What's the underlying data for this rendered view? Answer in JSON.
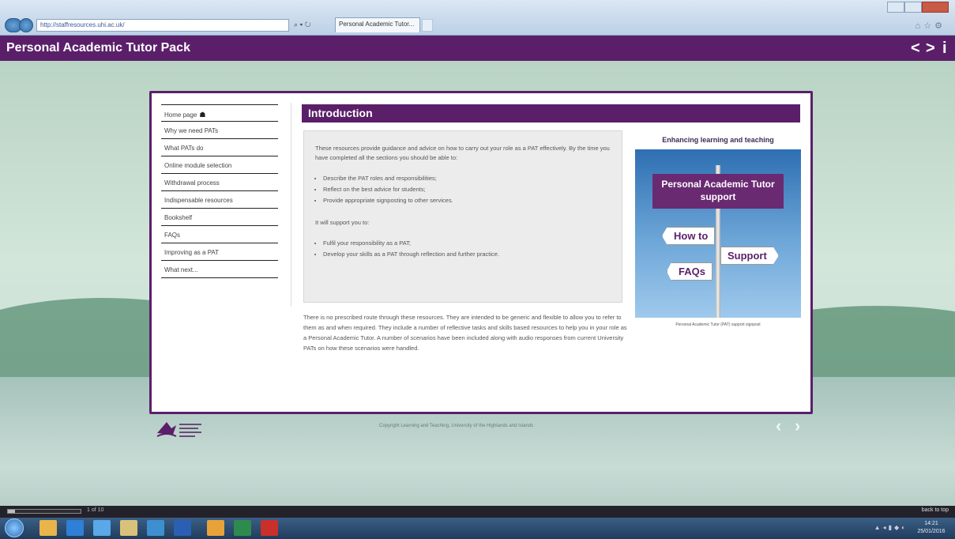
{
  "browser": {
    "address": "http://staffresources.uhi.ac.uk/",
    "tab_title": "Personal Academic Tutor...",
    "window_title": ""
  },
  "header": {
    "title": "Personal Academic Tutor Pack",
    "prev_label": "<",
    "next_label": ">",
    "info_label": "i"
  },
  "sidebar": {
    "items": [
      {
        "label": "Home page"
      },
      {
        "label": "Why we need PATs"
      },
      {
        "label": "What PATs do"
      },
      {
        "label": "Online module selection"
      },
      {
        "label": "Withdrawal process"
      },
      {
        "label": "Indispensable resources"
      },
      {
        "label": "Bookshelf"
      },
      {
        "label": "FAQs"
      },
      {
        "label": "Improving as a PAT"
      },
      {
        "label": "What next..."
      }
    ]
  },
  "main": {
    "heading": "Introduction",
    "intro_paragraph": "These resources provide guidance and advice on how to carry out your role as a PAT effectively. By the time you have completed all the sections you should be able to:",
    "outcomes": [
      "Describe the PAT roles and responsibilities;",
      "Reflect on the best advice for students;",
      "Provide appropriate signposting to other services."
    ],
    "support_intro": "It will support you to:",
    "supports": [
      "Fulfil your responsibility as a PAT;",
      "Develop your skills as a PAT through reflection and further practice."
    ],
    "body_paragraph": "There is no prescribed route through these resources. They are intended to be generic and flexible to allow you to refer to them as and when required. They include a number of reflective tasks and skills based resources to help you in your role as a Personal Academic Tutor. A number of scenarios have been included along with audio responses from current University PATs on how these scenarios were handled."
  },
  "aside": {
    "title": "Enhancing learning and teaching",
    "poster_banner": "Personal Academic Tutor support",
    "sign_howto": "How to",
    "sign_support": "Support",
    "sign_faqs": "FAQs",
    "caption": "Personal Academic Tutor (PAT) support signpost"
  },
  "footer": {
    "logo_text": "University of the Highlands and Islands",
    "copyright": "Copyright Learning and Teaching, University of the Highlands and Islands",
    "prev_label": "‹",
    "next_label": "›"
  },
  "status": {
    "page_count": "1 of 10",
    "progress": 0.1,
    "back_to_top": "back to top"
  },
  "taskbar": {
    "time": "14:21",
    "date": "25/01/2016"
  },
  "colors": {
    "brand_purple": "#5b1f6a",
    "poster_blue": "#2e6fb2"
  }
}
